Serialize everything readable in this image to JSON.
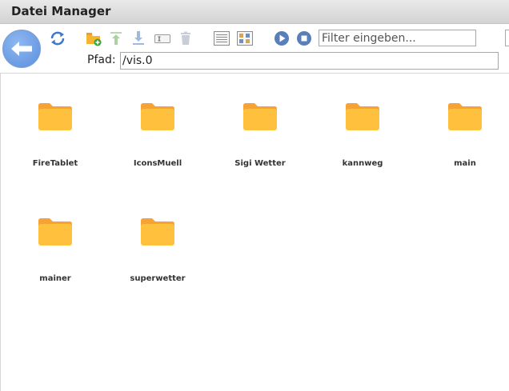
{
  "window": {
    "title": "Datei Manager"
  },
  "toolbar": {
    "buttons": [
      {
        "name": "refresh-icon"
      },
      {
        "name": "new-folder-icon"
      },
      {
        "name": "upload-icon"
      },
      {
        "name": "download-icon"
      },
      {
        "name": "rename-icon"
      },
      {
        "name": "delete-icon"
      },
      {
        "name": "list-view-icon"
      },
      {
        "name": "table-view-icon"
      },
      {
        "name": "play-icon"
      },
      {
        "name": "stop-icon"
      }
    ],
    "filter_placeholder": "Filter eingeben..."
  },
  "path": {
    "label": "Pfad:",
    "value": "/vis.0"
  },
  "folders": [
    {
      "label": "FireTablet"
    },
    {
      "label": "IconsMuell"
    },
    {
      "label": "Sigi Wetter"
    },
    {
      "label": "kannweg"
    },
    {
      "label": "main"
    },
    {
      "label": "mainer"
    },
    {
      "label": "superwetter"
    }
  ],
  "colors": {
    "folder": "#ffc13d",
    "folder_tab": "#f7a234",
    "accent": "#5a8ede"
  }
}
